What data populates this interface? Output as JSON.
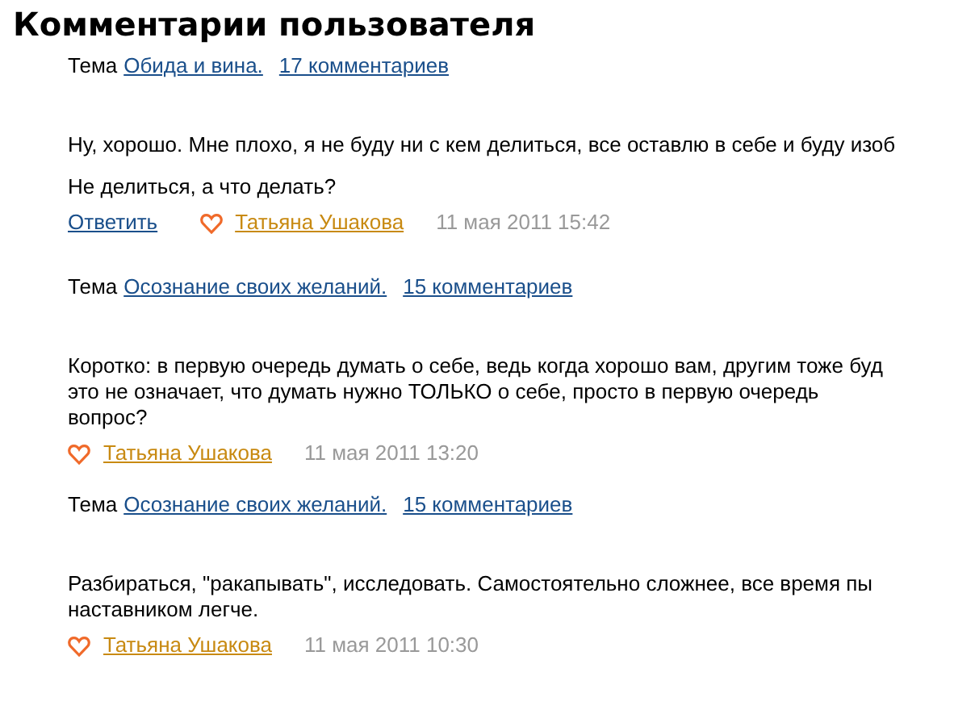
{
  "title": "Комментарии пользователя",
  "entries": [
    {
      "topic_prefix": "Тема",
      "topic": "Обида и вина.",
      "comments_count": "17 комментариев",
      "paragraphs": [
        [
          "Ну, хорошо. Мне плохо, я не буду ни с кем делиться, все оставлю в себе и буду изоб"
        ],
        [
          "Не делиться, а что делать?"
        ]
      ],
      "reply": "Ответить",
      "author": "Татьяна Ушакова",
      "date": "11 мая 2011 15:42"
    },
    {
      "topic_prefix": "Тема",
      "topic": "Осознание своих желаний.",
      "comments_count": "15 комментариев",
      "paragraphs": [
        [
          "Коротко: в первую очередь думать о себе, ведь когда хорошо вам, другим тоже буд",
          "это не означает, что думать нужно ТОЛЬКО о себе, просто в первую очередь",
          "вопрос?"
        ]
      ],
      "author": "Татьяна Ушакова",
      "date": "11 мая 2011 13:20"
    },
    {
      "topic_prefix": "Тема",
      "topic": "Осознание своих желаний.",
      "comments_count": "15 комментариев",
      "paragraphs": [
        [
          "Разбираться, \"ракапывать\", исследовать. Самостоятельно сложнее, все время пы",
          "наставником легче."
        ]
      ],
      "author": "Татьяна Ушакова",
      "date": "11 мая 2011 10:30"
    }
  ]
}
